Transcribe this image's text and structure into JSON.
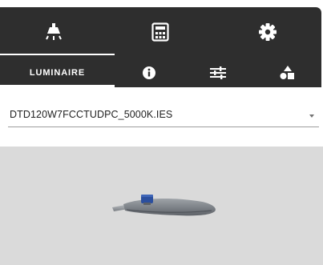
{
  "toolbar": {
    "top_tabs": [
      {
        "icon": "luminaire-lamp-icon",
        "active": true
      },
      {
        "icon": "calculator-icon",
        "active": false
      },
      {
        "icon": "gear-icon",
        "active": false
      }
    ],
    "sub_tabs": {
      "luminaire_label": "LUMINAIRE",
      "icons": [
        "info-icon",
        "sliders-icon",
        "shapes-icon"
      ]
    }
  },
  "luminaire_select": {
    "value": "DTD120W7FCCTUDPC_5000K.IES"
  },
  "colors": {
    "toolbar_bg": "#2e2e2e",
    "preview_bg": "#dadada",
    "sensor_blue": "#2b4f9e"
  }
}
